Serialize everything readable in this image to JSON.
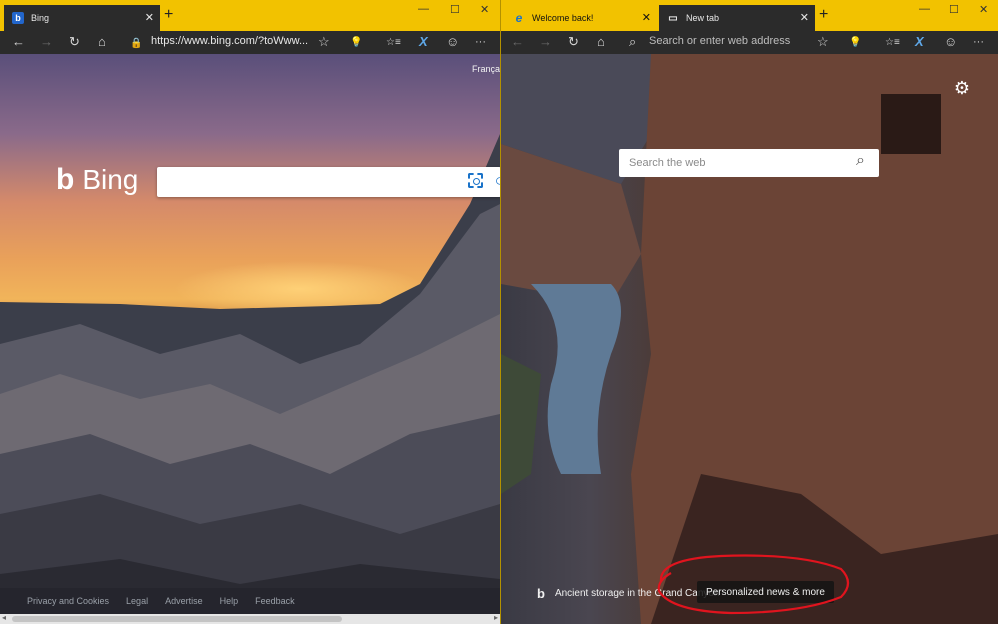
{
  "colors": {
    "tab_strip": "#f2c200",
    "toolbar": "#2b2b2b",
    "annotation": "#e0141e",
    "link_blue": "#1a73c9"
  },
  "left_window": {
    "tab": {
      "favicon": "b",
      "title": "Bing",
      "close": "✕"
    },
    "new_tab": "+",
    "window_controls": [
      "—",
      "☐",
      "✕"
    ],
    "toolbar": {
      "back": "←",
      "forward": "→",
      "refresh": "↻",
      "home": "⌂",
      "lock": "🔒",
      "url": "https://www.bing.com/?toWww...",
      "favorite": "☆",
      "reading": "💡",
      "favorites_hub": "☆≡",
      "extension": "X",
      "feedback": "☺",
      "more": "···"
    },
    "page": {
      "language_link": "França",
      "logo_text": "Bing",
      "footer_links": [
        "Privacy and Cookies",
        "Legal",
        "Advertise",
        "Help",
        "Feedback"
      ]
    }
  },
  "right_window": {
    "tabs": [
      {
        "favicon": "e",
        "title": "Welcome back!",
        "close": "✕"
      },
      {
        "favicon": "▭",
        "title": "New tab",
        "close": "✕"
      }
    ],
    "new_tab": "+",
    "window_controls": [
      "—",
      "☐",
      "✕"
    ],
    "toolbar": {
      "back": "←",
      "forward": "→",
      "refresh": "↻",
      "home": "⌂",
      "search_glyph": "⌕",
      "placeholder": "Search or enter web address",
      "favorite": "☆",
      "reading": "💡",
      "favorites_hub": "☆≡",
      "extension": "X",
      "feedback": "☺",
      "more": "···"
    },
    "page": {
      "search_placeholder": "Search the web",
      "image_caption": "Ancient storage in the Grand Canyon",
      "news_button": "Personalized news & more"
    }
  }
}
